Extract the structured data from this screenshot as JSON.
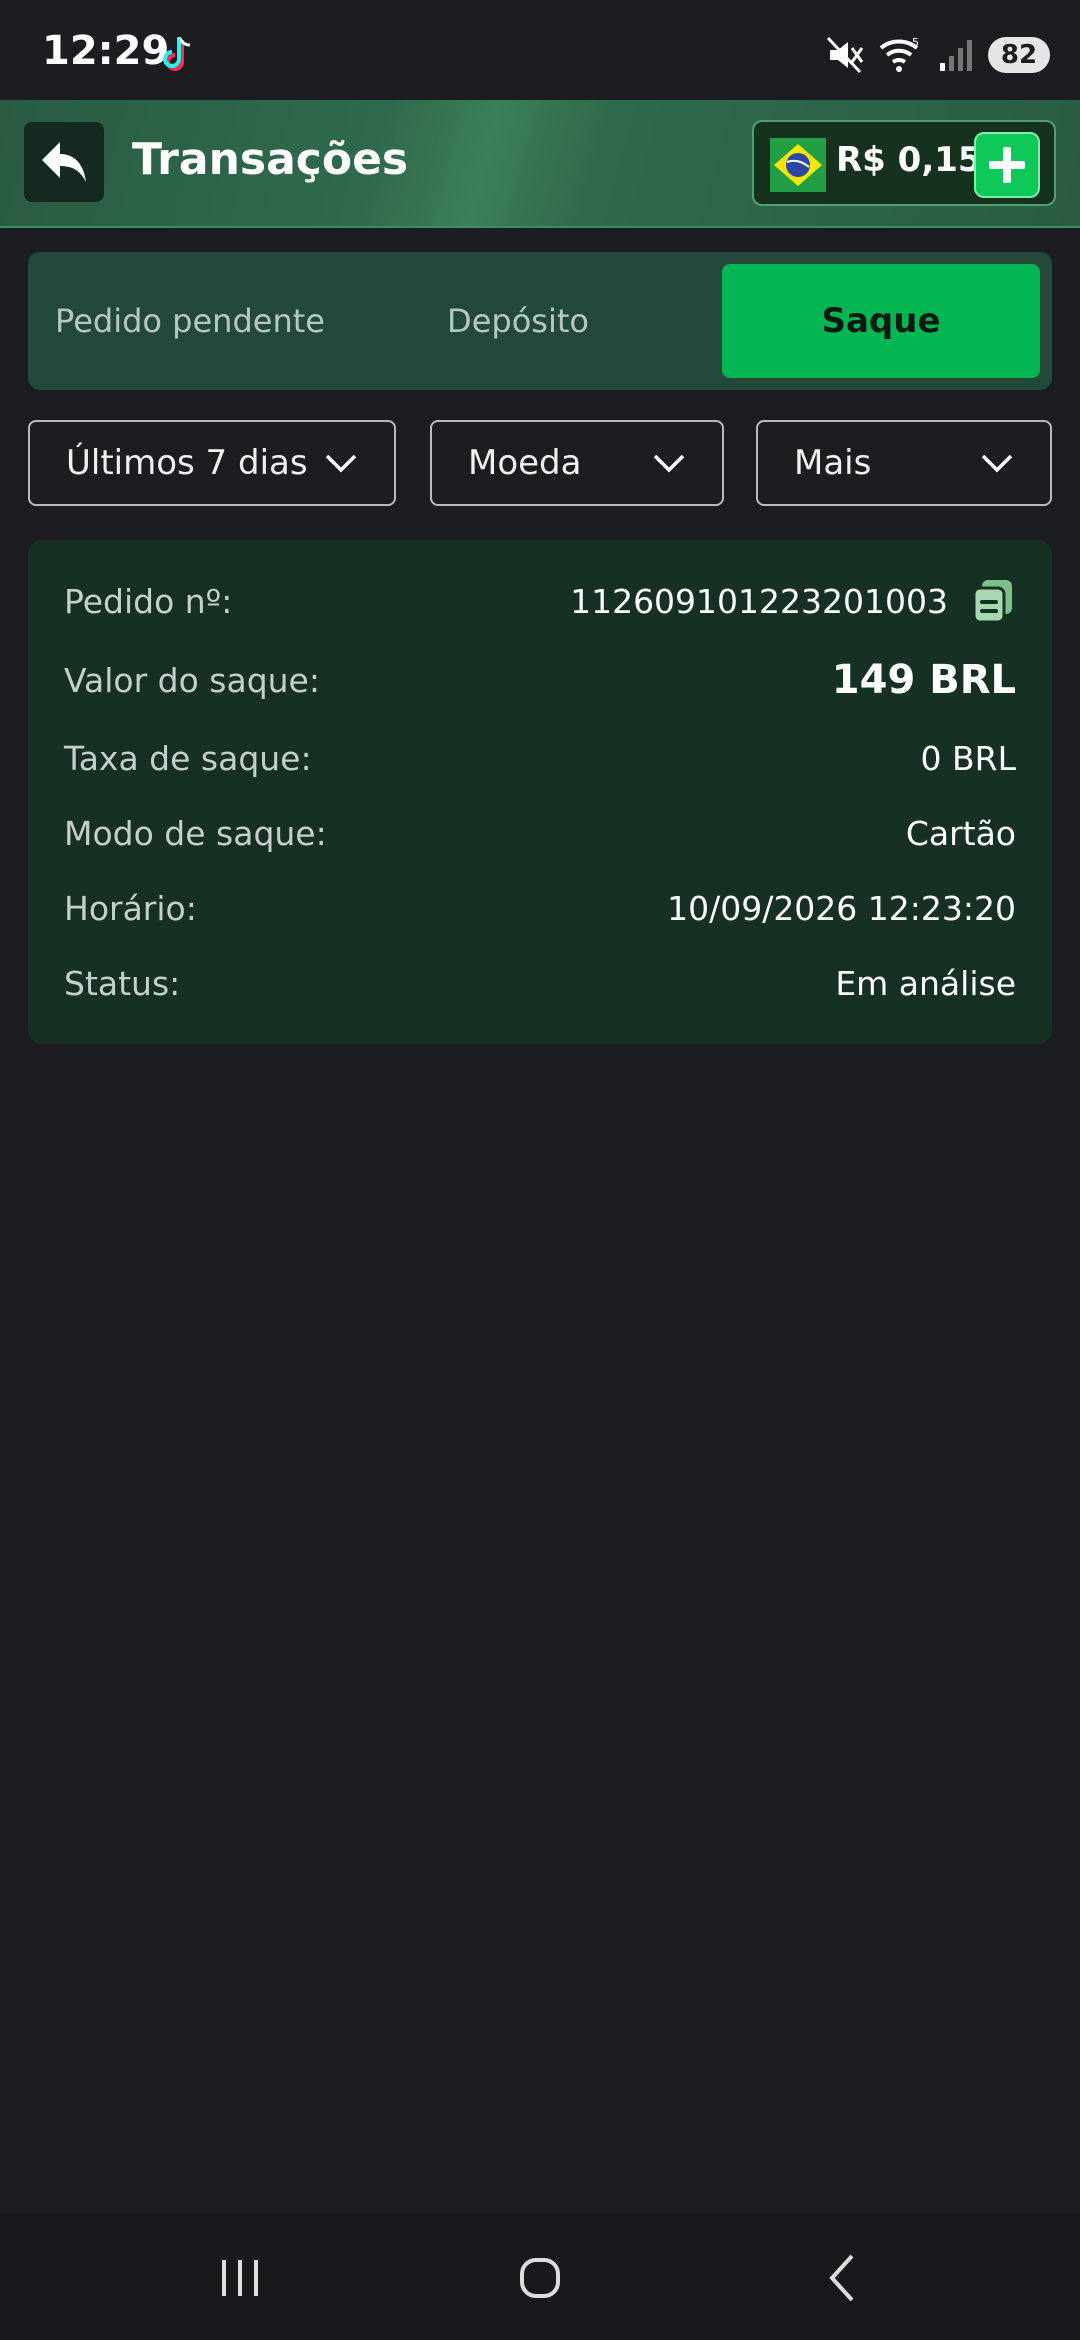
{
  "status_bar": {
    "time": "12:29",
    "battery": "82",
    "icons": [
      "tiktok-icon",
      "mute-icon",
      "wifi-icon",
      "signal-icon",
      "battery-icon"
    ]
  },
  "header": {
    "title": "Transações",
    "balance": "R$ 0,15",
    "icons": [
      "back-arrow-icon",
      "brazil-flag-icon",
      "plus-icon"
    ]
  },
  "tabs": [
    {
      "label": "Pedido pendente",
      "active": false
    },
    {
      "label": "Depósito",
      "active": false
    },
    {
      "label": "Saque",
      "active": true
    }
  ],
  "filters": {
    "days": "Últimos 7 dias",
    "currency": "Moeda",
    "more": "Mais"
  },
  "transaction": {
    "order_label": "Pedido nº:",
    "order_value": "112609101223201003",
    "amount_label": "Valor do saque:",
    "amount_value": "149 BRL",
    "fee_label": "Taxa de saque:",
    "fee_value": "0 BRL",
    "mode_label": "Modo de saque:",
    "mode_value": "Cartão",
    "time_label": "Horário:",
    "time_value": "10/09/2026 12:23:20",
    "status_label": "Status:",
    "status_value": "Em análise"
  },
  "colors": {
    "background": "#1c1d21",
    "accent_green": "#04b651",
    "card": "#163023",
    "header": "#2f6a4c"
  }
}
